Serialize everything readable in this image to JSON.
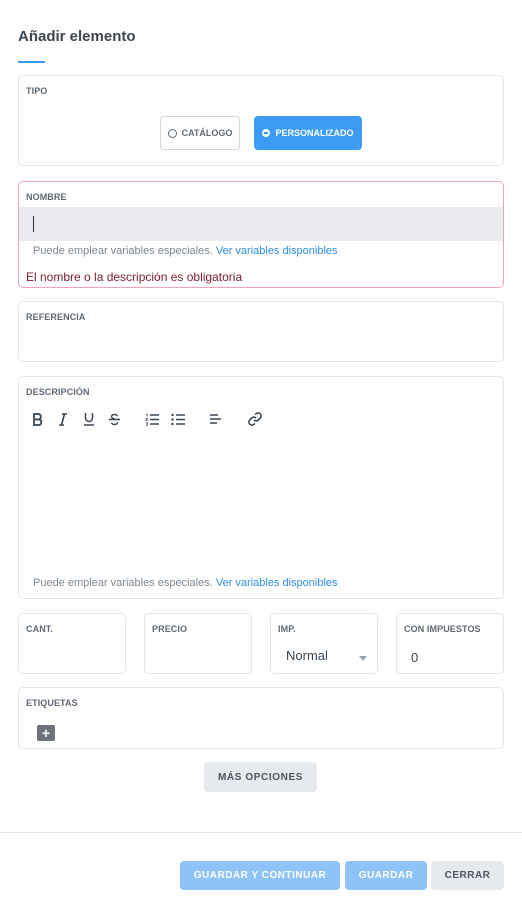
{
  "header": {
    "title": "Añadir elemento"
  },
  "tipo": {
    "label": "TIPO",
    "options": [
      {
        "label": "CATÁLOGO",
        "selected": false
      },
      {
        "label": "PERSONALIZADO",
        "selected": true
      }
    ]
  },
  "nombre": {
    "label": "NOMBRE",
    "value": "",
    "hint_text": "Puede emplear variables especiales.",
    "hint_link": "Ver variables disponibles",
    "error": "El nombre o la descripción es obligatoria"
  },
  "referencia": {
    "label": "REFERENCIA",
    "value": ""
  },
  "descripcion": {
    "label": "DESCRIPCIÓN",
    "toolbar": [
      "bold-icon",
      "italic-icon",
      "underline-icon",
      "strikethrough-icon",
      "ordered-list-icon",
      "bullet-list-icon",
      "align-left-icon",
      "link-icon"
    ],
    "hint_text": "Puede emplear variables especiales.",
    "hint_link": "Ver variables disponibles"
  },
  "cant": {
    "label": "CANT.",
    "value": ""
  },
  "precio": {
    "label": "PRECIO",
    "value": ""
  },
  "imp": {
    "label": "IMP.",
    "value": "Normal"
  },
  "con_impuestos": {
    "label": "CON IMPUESTOS",
    "value": "0"
  },
  "etiquetas": {
    "label": "ETIQUETAS",
    "add_icon": "plus-icon"
  },
  "mas_opciones": "MÁS OPCIONES",
  "footer": {
    "guardar_continuar": "GUARDAR Y CONTINUAR",
    "guardar": "GUARDAR",
    "cerrar": "CERRAR"
  },
  "colors": {
    "accent": "#3b9bf5",
    "accent_light": "#8ec3f7",
    "error_border": "#f2a3b3",
    "error_text": "#7a1c2c",
    "link": "#2f8de4"
  }
}
